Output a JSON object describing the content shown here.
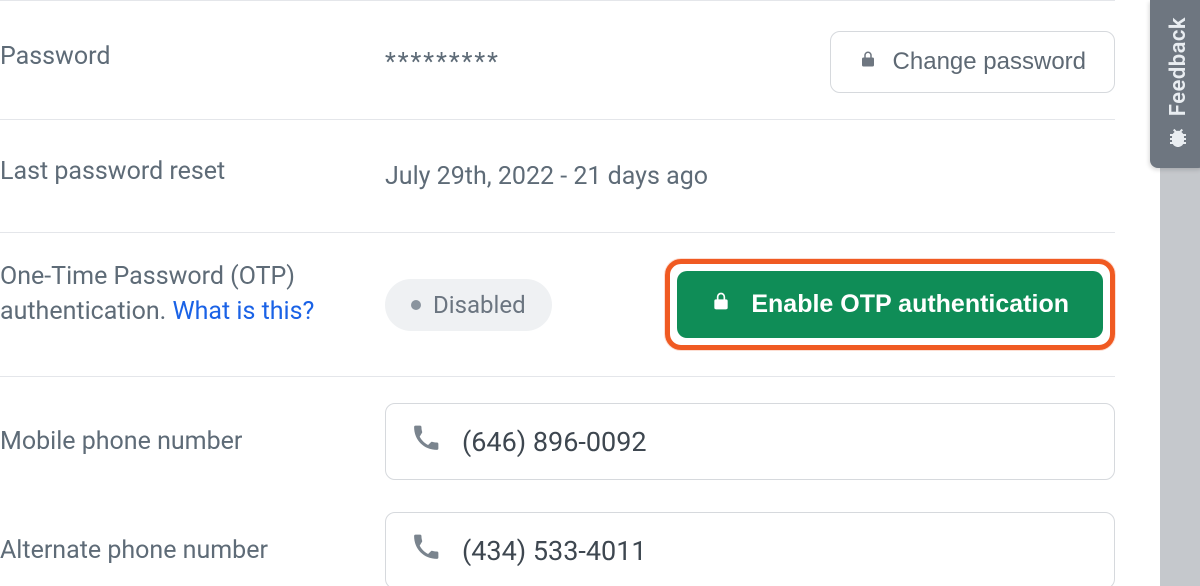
{
  "password": {
    "label": "Password",
    "mask": "*********",
    "change_button": "Change password"
  },
  "last_reset": {
    "label": "Last password reset",
    "value": "July 29th, 2022 - 21 days ago"
  },
  "otp": {
    "label_prefix": "One-Time Password (OTP) authentication. ",
    "link": "What is this?",
    "status": "Disabled",
    "enable_button": "Enable OTP authentication"
  },
  "mobile": {
    "label": "Mobile phone number",
    "value": "(646) 896-0092"
  },
  "alternate": {
    "label": "Alternate phone number",
    "value": "(434) 533-4011"
  },
  "feedback": {
    "label": "Feedback"
  }
}
